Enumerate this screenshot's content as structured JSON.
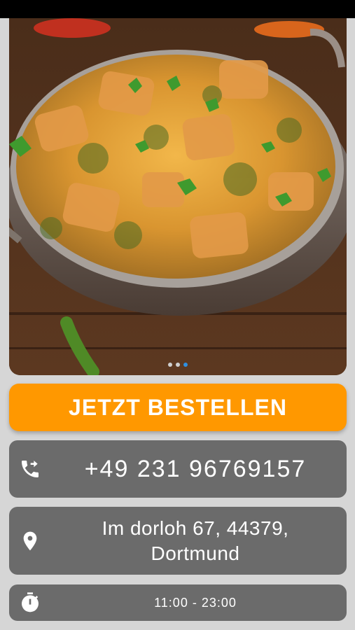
{
  "order_button": {
    "label": "JETZT BESTELLEN"
  },
  "contact": {
    "phone": "+49 231 96769157",
    "address_line1": "Im dorloh 67, 44379,",
    "address_line2": "Dortmund",
    "hours": "11:00 - 23:00"
  },
  "carousel": {
    "slides": 3,
    "active_index": 2
  },
  "icons": {
    "phone": "phone-forward-icon",
    "address": "location-pin-icon",
    "hours": "stopwatch-icon"
  },
  "colors": {
    "accent": "#ff9800",
    "card_bg": "#6b6b6b",
    "page_bg": "#d6d6d6",
    "active_dot": "#2f8fe0"
  }
}
